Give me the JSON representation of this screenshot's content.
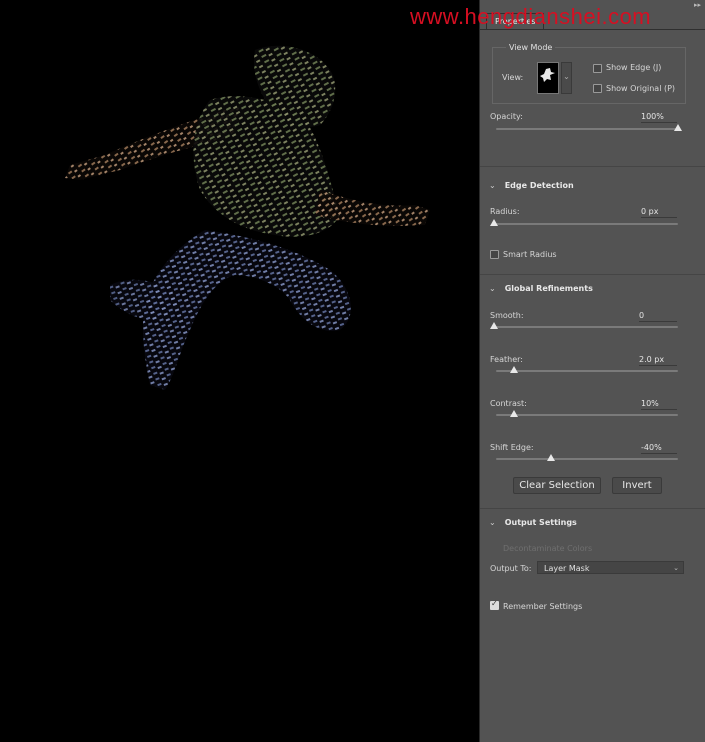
{
  "watermark": "www.hengdianshei.com",
  "panel": {
    "tab": "Properties",
    "view_mode": {
      "title": "View Mode",
      "view_label": "View:",
      "show_edge": "Show Edge (J)",
      "show_original": "Show Original (P)",
      "show_edge_checked": false,
      "show_original_checked": false
    },
    "opacity": {
      "label": "Opacity:",
      "value": "100%",
      "level": 1.0
    },
    "edge_detection": {
      "title": "Edge Detection",
      "radius_label": "Radius:",
      "radius_value": "0 px",
      "radius_level": 0.0,
      "smart_radius": "Smart Radius",
      "smart_radius_checked": false
    },
    "global_refinements": {
      "title": "Global Refinements",
      "smooth": {
        "label": "Smooth:",
        "value": "0",
        "level": 0.0
      },
      "feather": {
        "label": "Feather:",
        "value": "2.0 px",
        "level": 0.1
      },
      "contrast": {
        "label": "Contrast:",
        "value": "10%",
        "level": 0.1
      },
      "shift_edge": {
        "label": "Shift Edge:",
        "value": "-40%",
        "level": 0.3
      }
    },
    "buttons": {
      "clear_selection": "Clear Selection",
      "invert": "Invert"
    },
    "output_settings": {
      "title": "Output Settings",
      "decontaminate": "Decontaminate Colors",
      "output_to_label": "Output To:",
      "output_to_value": "Layer Mask"
    },
    "remember_settings": "Remember Settings",
    "remember_checked": true
  },
  "colors": {
    "panel_bg": "#535353",
    "canvas_bg": "#000000",
    "watermark": "#d60f22"
  }
}
